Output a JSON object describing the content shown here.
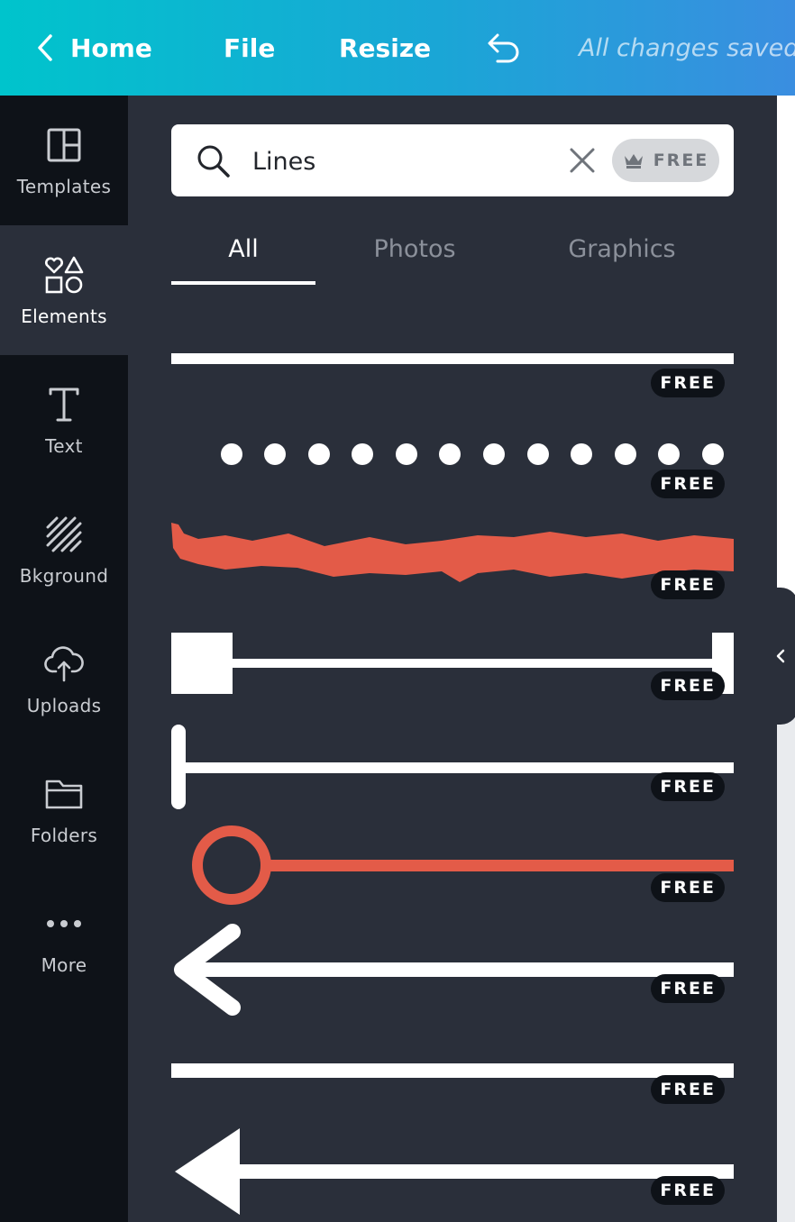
{
  "topbar": {
    "home_label": "Home",
    "file_label": "File",
    "resize_label": "Resize",
    "status": "All changes saved"
  },
  "nav": {
    "items": [
      {
        "label": "Templates",
        "icon": "templates-icon"
      },
      {
        "label": "Elements",
        "icon": "elements-icon",
        "active": true
      },
      {
        "label": "Text",
        "icon": "text-icon"
      },
      {
        "label": "Bkground",
        "icon": "background-icon"
      },
      {
        "label": "Uploads",
        "icon": "upload-cloud-icon"
      },
      {
        "label": "Folders",
        "icon": "folder-icon"
      },
      {
        "label": "More",
        "icon": "more-dots-icon"
      }
    ]
  },
  "search": {
    "value": "Lines",
    "free_label": "FREE"
  },
  "tabs": [
    {
      "label": "All",
      "active": true
    },
    {
      "label": "Photos"
    },
    {
      "label": "Graphics"
    }
  ],
  "results": [
    {
      "kind": "solid-line",
      "badge": "FREE"
    },
    {
      "kind": "dotted-line",
      "badge": "FREE"
    },
    {
      "kind": "brush-stroke-line",
      "badge": "FREE"
    },
    {
      "kind": "square-bracket-line",
      "badge": "FREE"
    },
    {
      "kind": "t-end-line",
      "badge": "FREE"
    },
    {
      "kind": "circle-end-line",
      "badge": "FREE"
    },
    {
      "kind": "arrow-line",
      "badge": "FREE"
    },
    {
      "kind": "thin-solid-line",
      "badge": "FREE"
    },
    {
      "kind": "triangle-arrow-line",
      "badge": "FREE"
    }
  ],
  "colors": {
    "accent_start": "#00c4cc",
    "accent_end": "#3a8ee0",
    "panel_bg": "#2a2f3a",
    "nav_bg": "#0e1218",
    "line_red": "#e35b48"
  }
}
